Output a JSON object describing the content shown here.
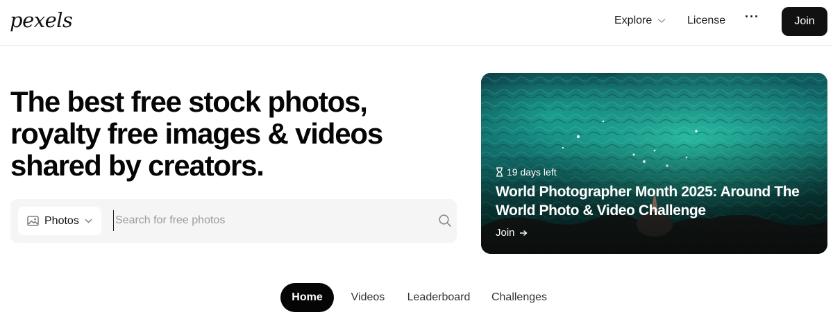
{
  "header": {
    "logo": "pexels",
    "nav": {
      "explore": "Explore",
      "license": "License",
      "more": "···",
      "join": "Join"
    }
  },
  "hero": {
    "title_line1": "The best free stock photos,",
    "title_line2": "royalty free images & videos",
    "title_line3": "shared by creators."
  },
  "search": {
    "type_label": "Photos",
    "placeholder": "Search for free photos",
    "value": ""
  },
  "challenge": {
    "days_left": "19 days left",
    "title": "World Photographer Month 2025: Around The World Photo & Video Challenge",
    "join_label": "Join"
  },
  "tabs": [
    {
      "label": "Home",
      "active": true
    },
    {
      "label": "Videos",
      "active": false
    },
    {
      "label": "Leaderboard",
      "active": false
    },
    {
      "label": "Challenges",
      "active": false
    }
  ],
  "colors": {
    "accent_dark": "#050505",
    "search_bg": "#f5f5f5",
    "water_teal": "#13a08a"
  },
  "icons": [
    "chevron-down-icon",
    "more-icon",
    "image-icon",
    "search-icon",
    "hourglass-icon",
    "arrow-right-icon"
  ]
}
